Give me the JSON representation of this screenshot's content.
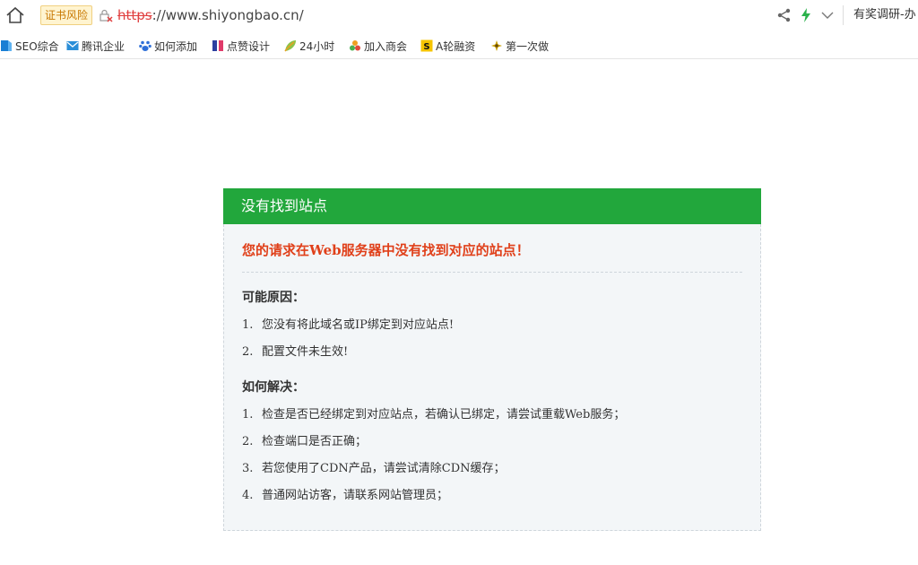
{
  "addressbar": {
    "cert_warning": "证书风险",
    "url_scheme": "https",
    "url_rest": "://www.shiyongbao.cn/",
    "promo_text": "有奖调研-办"
  },
  "bookmarks": [
    {
      "label": "SEO综合",
      "icon": "seo-icon",
      "color": "#1a7fd4"
    },
    {
      "label": "腾讯企业",
      "icon": "tencent-mail-icon",
      "color": "#2a8ed8"
    },
    {
      "label": "如何添加",
      "icon": "baidu-paw-icon",
      "color": "#2e6fd8"
    },
    {
      "label": "点赞设计",
      "icon": "design-icon",
      "color": "#2c3fa0"
    },
    {
      "label": "24小时",
      "icon": "leaf-icon",
      "color": "#e8a020"
    },
    {
      "label": "加入商会",
      "icon": "chamber-icon",
      "color": "#4caf50"
    },
    {
      "label": "A轮融资",
      "icon": "funding-icon",
      "color": "#f5c400"
    },
    {
      "label": "第一次做",
      "icon": "first-icon",
      "color": "#c8a000"
    }
  ],
  "panel": {
    "header": "没有找到站点",
    "error_title": "您的请求在Web服务器中没有找到对应的站点！",
    "reasons_title": "可能原因：",
    "reasons": [
      {
        "num": "1.",
        "text": "您没有将此域名或IP绑定到对应站点!"
      },
      {
        "num": "2.",
        "text": "配置文件未生效!"
      }
    ],
    "solutions_title": "如何解决：",
    "solutions": [
      {
        "num": "1.",
        "text": "检查是否已经绑定到对应站点，若确认已绑定，请尝试重载Web服务；"
      },
      {
        "num": "2.",
        "text": "检查端口是否正确；"
      },
      {
        "num": "3.",
        "text": "若您使用了CDN产品，请尝试清除CDN缓存；"
      },
      {
        "num": "4.",
        "text": "普通网站访客，请联系网站管理员；"
      }
    ]
  },
  "colors": {
    "header_green": "#22a73c",
    "error_red": "#e0401a",
    "panel_bg": "#f3f6f8"
  }
}
